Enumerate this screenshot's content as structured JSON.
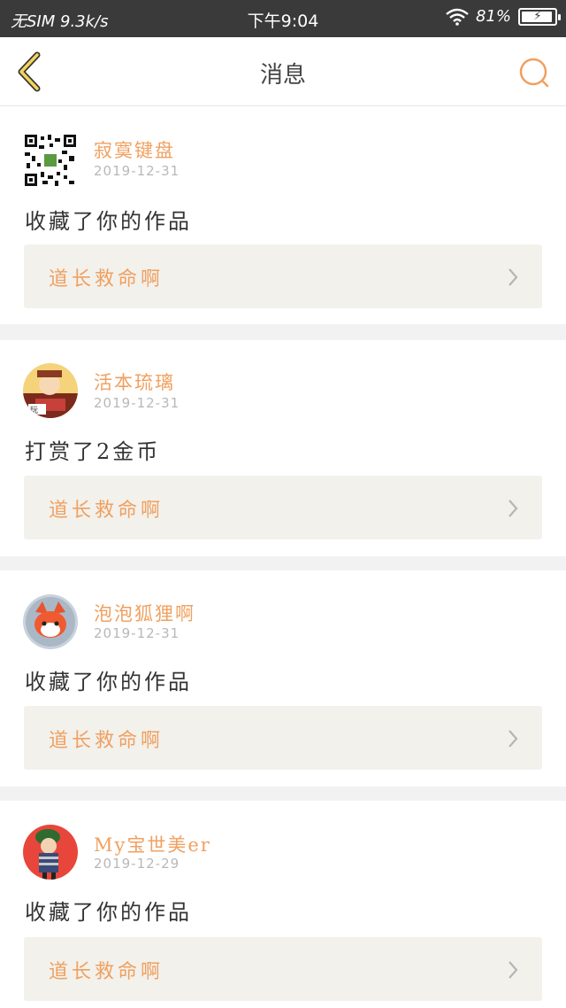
{
  "status_bar": {
    "carrier": "无SIM 9.3k/s",
    "time": "下午9:04",
    "battery": "81%",
    "battery_level": 0.81
  },
  "nav": {
    "title": "消息",
    "back_icon": "chevron-left-icon",
    "search_icon": "search-icon",
    "accent_color": "#f0a060"
  },
  "messages": [
    {
      "username": "寂寞键盘",
      "date": "2019-12-31",
      "action": "收藏了你的作品",
      "work_title": "道长救命啊",
      "avatar": "qr-avatar"
    },
    {
      "username": "活本琉璃",
      "date": "2019-12-31",
      "action": "打赏了2金币",
      "work_title": "道长救命啊",
      "avatar": "monk-avatar"
    },
    {
      "username": "泡泡狐狸啊",
      "date": "2019-12-31",
      "action": "收藏了你的作品",
      "work_title": "道长救命啊",
      "avatar": "fox-avatar"
    },
    {
      "username": "My宝世美er",
      "date": "2019-12-29",
      "action": "收藏了你的作品",
      "work_title": "道长救命啊",
      "avatar": "girl-avatar"
    }
  ]
}
